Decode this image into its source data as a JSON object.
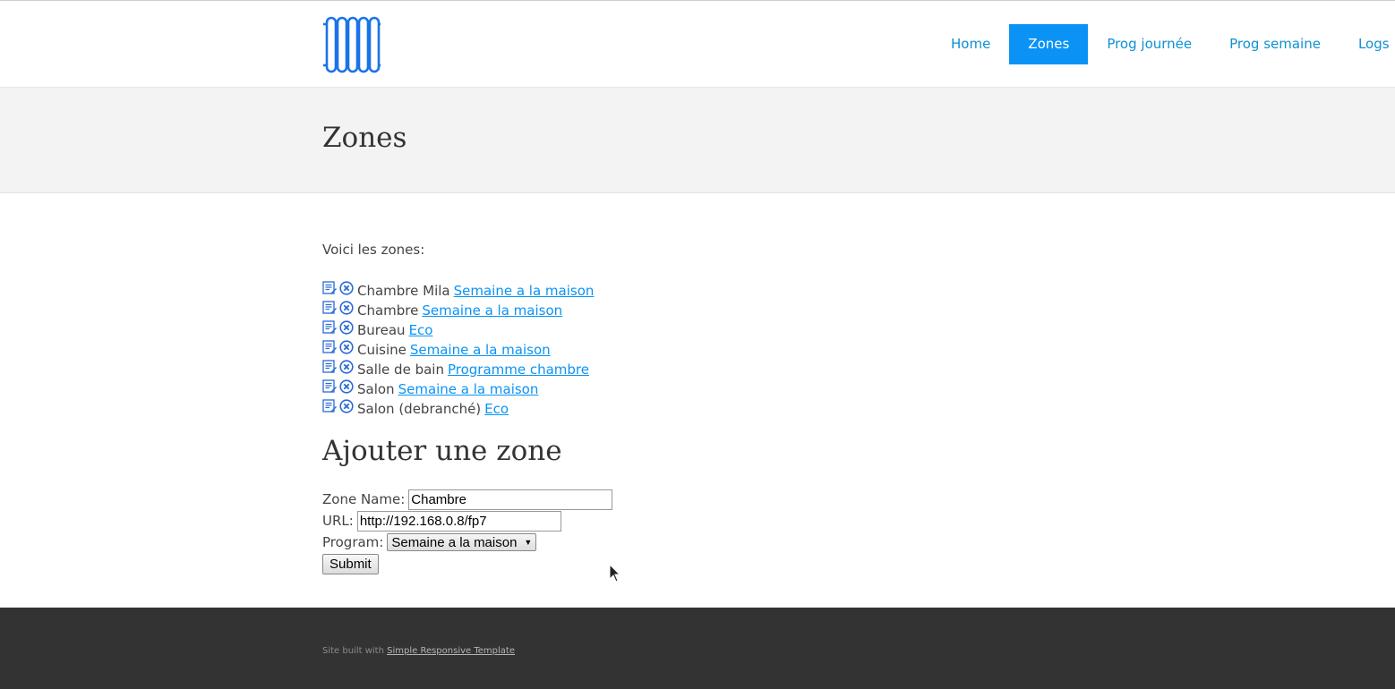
{
  "nav": {
    "items": [
      {
        "label": "Home",
        "active": false
      },
      {
        "label": "Zones",
        "active": true
      },
      {
        "label": "Prog journée",
        "active": false
      },
      {
        "label": "Prog semaine",
        "active": false
      },
      {
        "label": "Logs",
        "active": false
      }
    ]
  },
  "logo": {
    "icon": "radiator-icon",
    "color": "#1a73e8"
  },
  "banner": {
    "title": "Zones"
  },
  "content": {
    "intro": "Voici les zones:",
    "zones": [
      {
        "name": "Chambre Mila",
        "program": "Semaine a la maison"
      },
      {
        "name": "Chambre",
        "program": "Semaine a la maison"
      },
      {
        "name": "Bureau",
        "program": "Eco"
      },
      {
        "name": "Cuisine",
        "program": "Semaine a la maison"
      },
      {
        "name": "Salle de bain",
        "program": "Programme chambre"
      },
      {
        "name": "Salon",
        "program": "Semaine a la maison"
      },
      {
        "name": "Salon (debranché)",
        "program": "Eco"
      }
    ],
    "zone_icons": {
      "edit": "edit-document-icon",
      "delete": "delete-circle-icon"
    }
  },
  "add_form": {
    "title": "Ajouter une zone",
    "zone_name_label": "Zone Name:",
    "zone_name_value": "Chambre",
    "url_label": "URL:",
    "url_value": "http://192.168.0.8/fp7",
    "program_label": "Program:",
    "program_selected": "Semaine a la maison",
    "submit_label": "Submit"
  },
  "footer": {
    "text": "Site built with",
    "link": "Simple Responsive Template"
  },
  "colors": {
    "accent": "#0a93f5",
    "footer_bg": "#333333",
    "banner_bg": "#f3f3f3"
  }
}
